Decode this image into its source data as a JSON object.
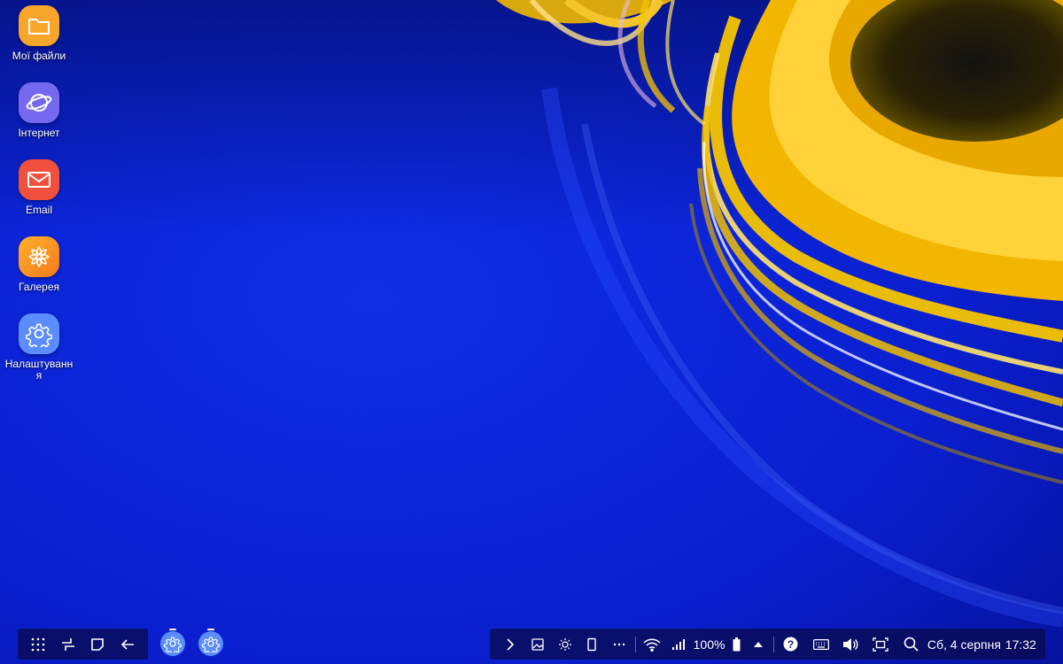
{
  "theme": {
    "desktop_bg": "#0a20d8",
    "taskbar_bg": "#0a0a46",
    "accent_yellow": "#f5c400"
  },
  "desktop": {
    "icons": [
      {
        "label": "Мої файли",
        "icon": "folder-icon",
        "color": "#f7a52b"
      },
      {
        "label": "Інтернет",
        "icon": "internet-planet-icon",
        "color": "#7569f0"
      },
      {
        "label": "Email",
        "icon": "email-envelope-icon",
        "color": "#f0503c"
      },
      {
        "label": "Галерея",
        "icon": "gallery-flower-icon",
        "color": "#f8a12a"
      },
      {
        "label": "Налаштування",
        "icon": "settings-gear-icon",
        "color": "#5b8dff"
      }
    ]
  },
  "taskbar_left": {
    "buttons": [
      "app-drawer-icon",
      "recent-apps-icon",
      "home-icon",
      "back-icon"
    ]
  },
  "running_apps": [
    {
      "icon": "settings-gear-icon",
      "color": "#5b8dff"
    },
    {
      "icon": "settings-gear-icon",
      "color": "#5b8dff"
    }
  ],
  "status_bar": {
    "battery_text": "100%",
    "date_text": "Сб, 4 серпня",
    "time_text": "17:32"
  }
}
